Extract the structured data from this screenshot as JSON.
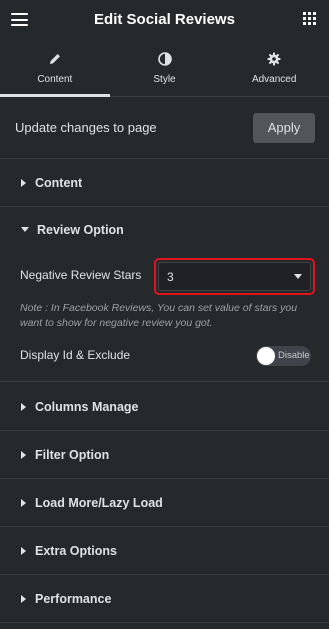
{
  "header": {
    "title": "Edit Social Reviews"
  },
  "tabs": [
    {
      "label": "Content",
      "icon": "pencil-icon",
      "active": true
    },
    {
      "label": "Style",
      "icon": "half-circle-icon",
      "active": false
    },
    {
      "label": "Advanced",
      "icon": "gear-icon",
      "active": false
    }
  ],
  "update": {
    "label": "Update changes to page",
    "button": "Apply"
  },
  "sections": {
    "content": "Content",
    "review_option": "Review Option",
    "columns_manage": "Columns Manage",
    "filter_option": "Filter Option",
    "load_more": "Load More/Lazy Load",
    "extra_options": "Extra Options",
    "performance": "Performance"
  },
  "review_option": {
    "negative_label": "Negative Review Stars",
    "negative_value": "3",
    "note": "Note : In Facebook Reviews, You can set value of stars you want to show for negative review you got.",
    "display_label": "Display Id & Exclude",
    "toggle_text": "Disable"
  },
  "colors": {
    "highlight": "#e0141e",
    "panel": "#26292c"
  }
}
